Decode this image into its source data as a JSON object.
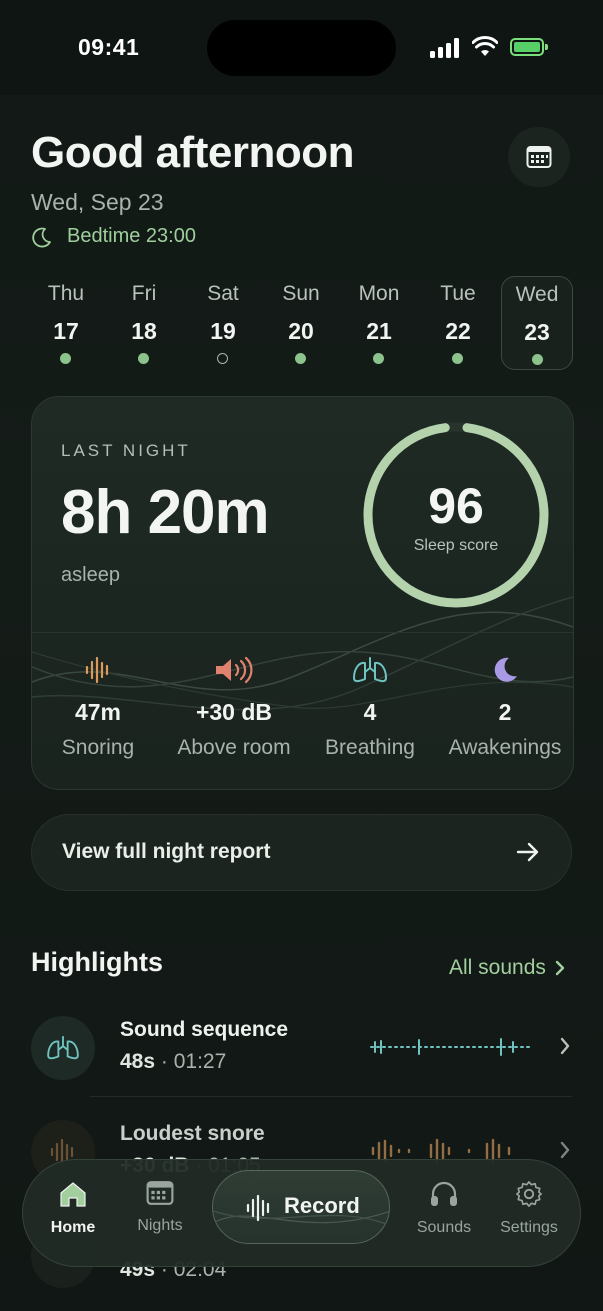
{
  "status": {
    "time": "09:41"
  },
  "header": {
    "greeting": "Good afternoon",
    "date": "Wed, Sep 23",
    "bedtime": "Bedtime 23:00"
  },
  "week": [
    {
      "name": "Thu",
      "num": "17",
      "recorded": true
    },
    {
      "name": "Fri",
      "num": "18",
      "recorded": true
    },
    {
      "name": "Sat",
      "num": "19",
      "recorded": false
    },
    {
      "name": "Sun",
      "num": "20",
      "recorded": true
    },
    {
      "name": "Mon",
      "num": "21",
      "recorded": true
    },
    {
      "name": "Tue",
      "num": "22",
      "recorded": true
    },
    {
      "name": "Wed",
      "num": "23",
      "recorded": true,
      "selected": true
    }
  ],
  "last_night": {
    "label": "LAST NIGHT",
    "duration": "8h 20m",
    "sub": "asleep",
    "score": "96",
    "score_label": "Sleep score",
    "score_fraction": 0.96,
    "stats": [
      {
        "value": "47m",
        "label": "Snoring",
        "icon": "snore-waveform-icon",
        "color": "#d99a5b"
      },
      {
        "value": "+30 dB",
        "label": "Above room",
        "icon": "speaker-icon",
        "color": "#e0826d"
      },
      {
        "value": "4",
        "label": "Breathing",
        "icon": "lungs-icon",
        "color": "#6fc3c0"
      },
      {
        "value": "2",
        "label": "Awakenings",
        "icon": "moon-icon",
        "color": "#a99ae6"
      }
    ]
  },
  "report_button": "View full night report",
  "highlights": {
    "title": "Highlights",
    "all_sounds": "All sounds",
    "items": [
      {
        "title": "Sound sequence",
        "duration": "48s",
        "time": "01:27",
        "icon": "lungs-icon"
      },
      {
        "title": "Loudest snore",
        "duration": "+30 dB",
        "time": "01:05",
        "icon": "snore-waveform-icon"
      },
      {
        "title": "",
        "duration": "49s",
        "time": "02:04",
        "icon": "moon-icon"
      }
    ]
  },
  "tabs": [
    {
      "label": "Home",
      "icon": "home-icon",
      "active": true
    },
    {
      "label": "Nights",
      "icon": "calendar-icon"
    },
    {
      "label": "Record",
      "icon": "waveform-icon"
    },
    {
      "label": "Sounds",
      "icon": "headphones-icon"
    },
    {
      "label": "Settings",
      "icon": "gear-icon"
    }
  ],
  "colors": {
    "accent": "#a3cf9f",
    "background": "#121915",
    "card": "#1d2822"
  }
}
